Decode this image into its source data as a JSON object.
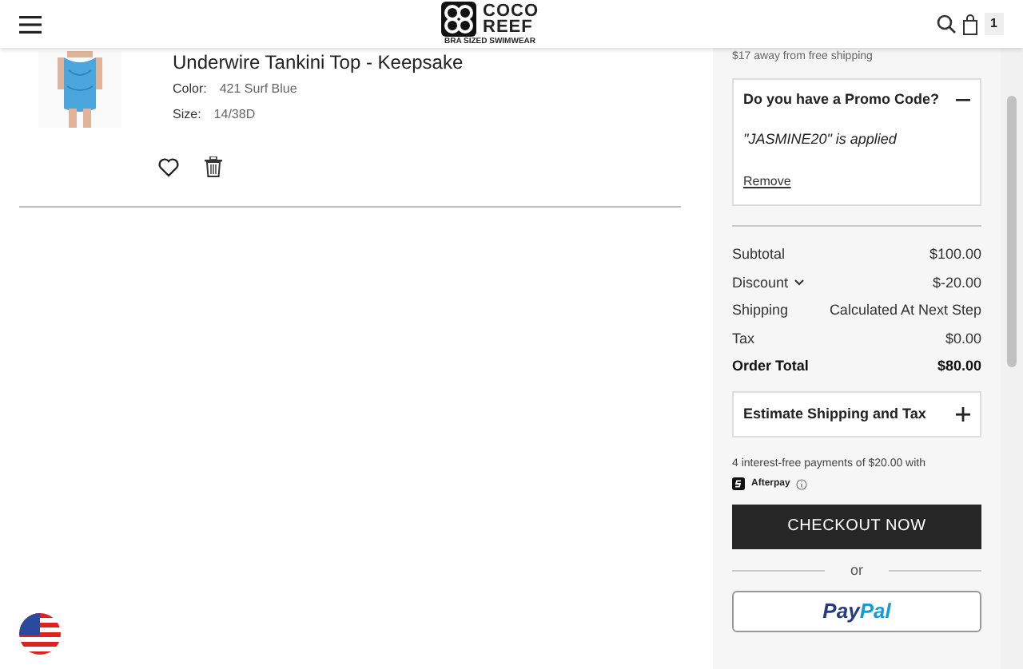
{
  "header": {
    "logo_top": "COCO",
    "logo_bottom": "REEF",
    "logo_tagline": "BRA SIZED SWIMWEAR",
    "cart_count": "1"
  },
  "cart_item": {
    "title": "Underwire Tankini Top - Keepsake",
    "attributes": [
      {
        "label": "Color:",
        "value": "421 Surf Blue"
      },
      {
        "label": "Size:",
        "value": "14/38D"
      }
    ]
  },
  "summary": {
    "free_shipping_note": "$17 away from free shipping",
    "promo": {
      "title": "Do you have a Promo Code?",
      "expanded": true,
      "applied_text": "\"JASMINE20\" is applied",
      "remove_link": "Remove"
    },
    "lines": [
      {
        "label": "Subtotal",
        "value": "$100.00",
        "kind": "plain"
      },
      {
        "label": "Discount",
        "value": "$-20.00",
        "kind": "dropdown"
      },
      {
        "label": "Shipping",
        "value": "Calculated At Next Step",
        "kind": "plain"
      },
      {
        "label": "Tax",
        "value": "$0.00",
        "kind": "plain"
      },
      {
        "label": "Order Total",
        "value": "$80.00",
        "kind": "total"
      }
    ],
    "estimate": {
      "title": "Estimate Shipping and Tax",
      "expanded": false
    },
    "afterpay_text": "4 interest-free payments of $20.00 with",
    "afterpay_brand": "Afterpay",
    "checkout_button": "CHECKOUT NOW",
    "or_text": "or",
    "paypal_pay": "Pay",
    "paypal_pal": "Pal"
  }
}
